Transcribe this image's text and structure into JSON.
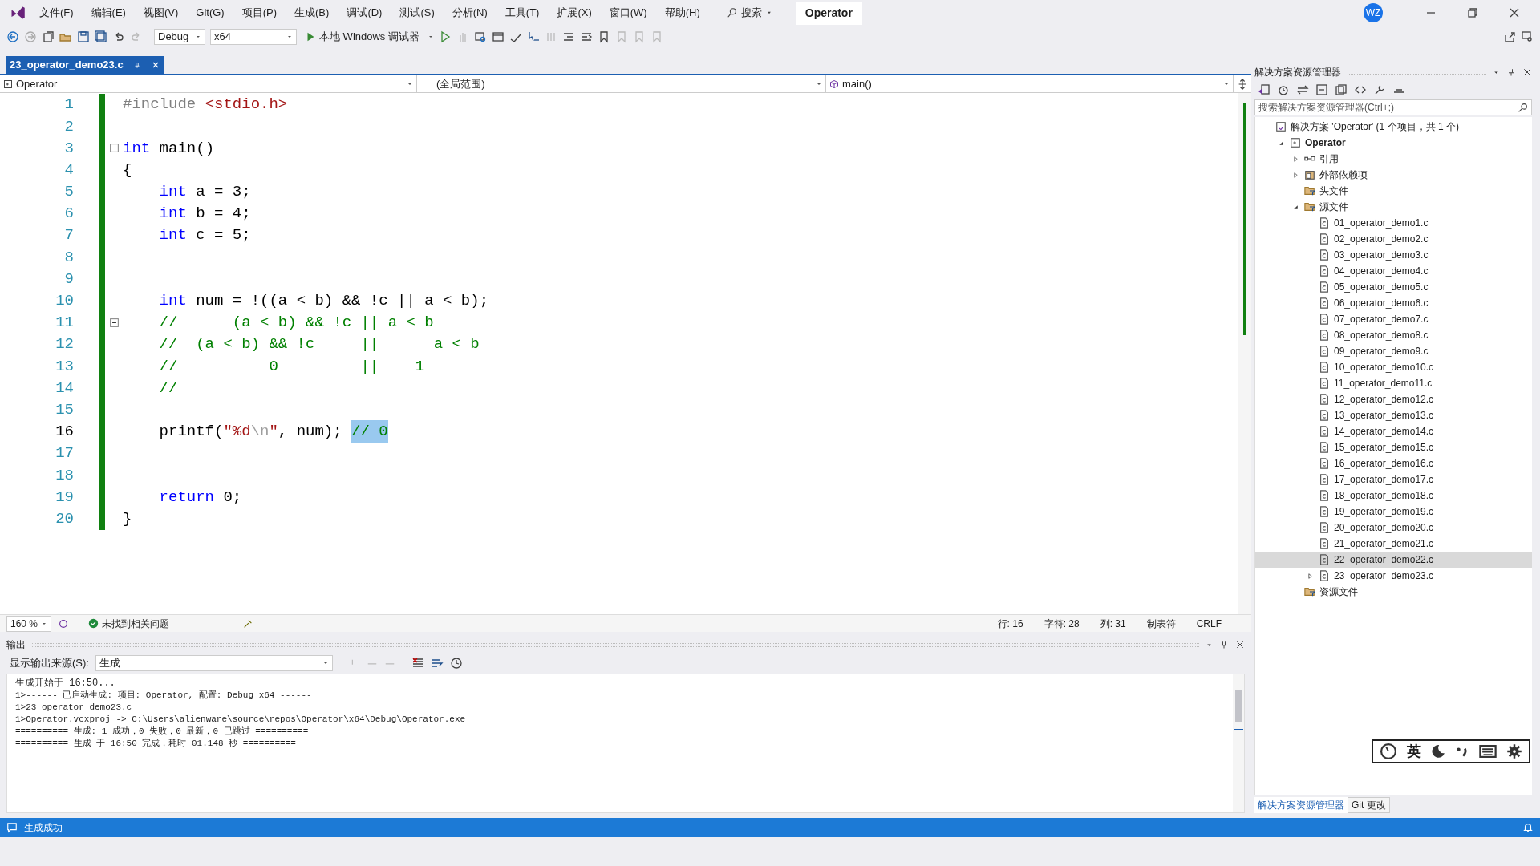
{
  "menu": [
    "文件(F)",
    "编辑(E)",
    "视图(V)",
    "Git(G)",
    "项目(P)",
    "生成(B)",
    "调试(D)",
    "测试(S)",
    "分析(N)",
    "工具(T)",
    "扩展(X)",
    "窗口(W)",
    "帮助(H)"
  ],
  "search": {
    "label": "搜索"
  },
  "window": {
    "title": "Operator",
    "avatar": "WZ"
  },
  "toolbar": {
    "configuration": "Debug",
    "platform": "x64",
    "debugger": "本地 Windows 调试器"
  },
  "tabs": [
    {
      "label": "23_operator_demo23.c",
      "selected": true
    }
  ],
  "navigation": {
    "project": "Operator",
    "scope": "(全局范围)",
    "member": "main()"
  },
  "code": [
    {
      "number": "1",
      "current": false,
      "foldable": false,
      "indented": false,
      "tokens": [
        {
          "text": "#include ",
          "kind": "preprocessor"
        },
        {
          "text": "<stdio.h>",
          "kind": "string"
        }
      ]
    },
    {
      "number": "2",
      "current": false,
      "foldable": false
    },
    {
      "number": "3",
      "current": false,
      "foldable": true,
      "indented": false,
      "tokens": [
        {
          "text": "int",
          "kind": "keyword"
        },
        {
          "text": " main()",
          "kind": "plain"
        }
      ]
    },
    {
      "number": "4",
      "current": false,
      "foldable": false,
      "indented": false,
      "tokens": [
        {
          "text": "{",
          "kind": "plain"
        }
      ]
    },
    {
      "number": "5",
      "current": false,
      "foldable": false,
      "indented": true,
      "tokens": [
        {
          "text": "int",
          "kind": "keyword"
        },
        {
          "text": " a = 3;",
          "kind": "plain"
        }
      ]
    },
    {
      "number": "6",
      "current": false,
      "foldable": false,
      "indented": true,
      "tokens": [
        {
          "text": "int",
          "kind": "keyword"
        },
        {
          "text": " b = 4;",
          "kind": "plain"
        }
      ]
    },
    {
      "number": "7",
      "current": false,
      "foldable": false,
      "indented": true,
      "tokens": [
        {
          "text": "int",
          "kind": "keyword"
        },
        {
          "text": " c = 5;",
          "kind": "plain"
        }
      ]
    },
    {
      "number": "8",
      "current": false,
      "foldable": false
    },
    {
      "number": "9",
      "current": false,
      "foldable": false
    },
    {
      "number": "10",
      "current": false,
      "foldable": false,
      "indented": true,
      "tokens": [
        {
          "text": "int",
          "kind": "keyword"
        },
        {
          "text": " num = !((a < b) && !c || a < b);",
          "kind": "plain"
        }
      ]
    },
    {
      "number": "11",
      "current": false,
      "foldable": true,
      "indented": true,
      "tokens": [
        {
          "text": "//      (a < b) && !c || a < b",
          "kind": "comment"
        }
      ]
    },
    {
      "number": "12",
      "current": false,
      "foldable": false,
      "indented": true,
      "tokens": [
        {
          "text": "//  (a < b) && !c     ||      a < b",
          "kind": "comment"
        }
      ]
    },
    {
      "number": "13",
      "current": false,
      "foldable": false,
      "indented": true,
      "tokens": [
        {
          "text": "//          0         ||    1",
          "kind": "comment"
        }
      ]
    },
    {
      "number": "14",
      "current": false,
      "foldable": false,
      "indented": true,
      "tokens": [
        {
          "text": "//",
          "kind": "comment"
        }
      ]
    },
    {
      "number": "15",
      "current": false,
      "foldable": false
    },
    {
      "number": "16",
      "current": true,
      "foldable": false,
      "indented": true,
      "tokens": [
        {
          "text": "printf(",
          "kind": "plain"
        },
        {
          "text": "\"%d",
          "kind": "string"
        },
        {
          "text": "\\n",
          "kind": "escape"
        },
        {
          "text": "\"",
          "kind": "string"
        },
        {
          "text": ", num); ",
          "kind": "plain"
        }
      ],
      "selection": "// 0"
    },
    {
      "number": "17",
      "current": false,
      "foldable": false
    },
    {
      "number": "18",
      "current": false,
      "foldable": false
    },
    {
      "number": "19",
      "current": false,
      "foldable": false,
      "indented": true,
      "tokens": [
        {
          "text": "return",
          "kind": "keyword"
        },
        {
          "text": " 0;",
          "kind": "plain"
        }
      ]
    },
    {
      "number": "20",
      "current": false,
      "foldable": false,
      "indented": false,
      "tokens": [
        {
          "text": "}",
          "kind": "plain"
        }
      ]
    }
  ],
  "editor_status": {
    "zoom": "160 %",
    "issues": "未找到相关问题",
    "line": "行: 16",
    "char": "字符: 28",
    "col": "列: 31",
    "tabs": "制表符",
    "eol": "CRLF"
  },
  "output": {
    "title": "输出",
    "source_label": "显示输出来源(S):",
    "source": "生成",
    "lines": [
      "生成开始于 16:50...",
      "1>------ 已启动生成: 项目: Operator, 配置: Debug x64 ------",
      "1>23_operator_demo23.c",
      "1>Operator.vcxproj -> C:\\Users\\alienware\\source\\repos\\Operator\\x64\\Debug\\Operator.exe",
      "========== 生成: 1 成功，0 失败，0 最新，0 已跳过 ==========",
      "========== 生成 于 16:50 完成，耗时 01.148 秒 =========="
    ]
  },
  "status_bar": {
    "text": "生成成功"
  },
  "solution_explorer": {
    "title": "解决方案资源管理器",
    "placeholder": "搜索解决方案资源管理器(Ctrl+;)",
    "tree": [
      {
        "label": "解决方案 'Operator' (1 个项目，共 1 个)",
        "kind": "solution",
        "selected": false,
        "children": [
          {
            "label": "Operator",
            "kind": "project",
            "expanded": true,
            "selected": false,
            "children": [
              {
                "label": "引用",
                "kind": "refs",
                "expanded": false,
                "selected": false
              },
              {
                "label": "外部依赖项",
                "kind": "deps",
                "expanded": false,
                "selected": false
              },
              {
                "label": "头文件",
                "kind": "filter",
                "selected": false
              },
              {
                "label": "源文件",
                "kind": "filter",
                "expanded": true,
                "selected": false,
                "children": [
                  {
                    "label": "01_operator_demo1.c",
                    "kind": "file",
                    "selected": false
                  },
                  {
                    "label": "02_operator_demo2.c",
                    "kind": "file",
                    "selected": false
                  },
                  {
                    "label": "03_operator_demo3.c",
                    "kind": "file",
                    "selected": false
                  },
                  {
                    "label": "04_operator_demo4.c",
                    "kind": "file",
                    "selected": false
                  },
                  {
                    "label": "05_operator_demo5.c",
                    "kind": "file",
                    "selected": false
                  },
                  {
                    "label": "06_operator_demo6.c",
                    "kind": "file",
                    "selected": false
                  },
                  {
                    "label": "07_operator_demo7.c",
                    "kind": "file",
                    "selected": false
                  },
                  {
                    "label": "08_operator_demo8.c",
                    "kind": "file",
                    "selected": false
                  },
                  {
                    "label": "09_operator_demo9.c",
                    "kind": "file",
                    "selected": false
                  },
                  {
                    "label": "10_operator_demo10.c",
                    "kind": "file",
                    "selected": false
                  },
                  {
                    "label": "11_operator_demo11.c",
                    "kind": "file",
                    "selected": false
                  },
                  {
                    "label": "12_operator_demo12.c",
                    "kind": "file",
                    "selected": false
                  },
                  {
                    "label": "13_operator_demo13.c",
                    "kind": "file",
                    "selected": false
                  },
                  {
                    "label": "14_operator_demo14.c",
                    "kind": "file",
                    "selected": false
                  },
                  {
                    "label": "15_operator_demo15.c",
                    "kind": "file",
                    "selected": false
                  },
                  {
                    "label": "16_operator_demo16.c",
                    "kind": "file",
                    "selected": false
                  },
                  {
                    "label": "17_operator_demo17.c",
                    "kind": "file",
                    "selected": false
                  },
                  {
                    "label": "18_operator_demo18.c",
                    "kind": "file",
                    "selected": false
                  },
                  {
                    "label": "19_operator_demo19.c",
                    "kind": "file",
                    "selected": false
                  },
                  {
                    "label": "20_operator_demo20.c",
                    "kind": "file",
                    "selected": false
                  },
                  {
                    "label": "21_operator_demo21.c",
                    "kind": "file",
                    "selected": false
                  },
                  {
                    "label": "22_operator_demo22.c",
                    "kind": "file",
                    "selected": true
                  },
                  {
                    "label": "23_operator_demo23.c",
                    "kind": "file",
                    "expanded": false,
                    "selected": false
                  }
                ]
              },
              {
                "label": "资源文件",
                "kind": "filter",
                "selected": false
              }
            ]
          }
        ]
      }
    ],
    "bottom_tabs": [
      {
        "label": "解决方案资源管理器",
        "selected": true
      },
      {
        "label": "Git 更改",
        "selected": false
      }
    ]
  },
  "ime_bar": {
    "mode": "英"
  }
}
